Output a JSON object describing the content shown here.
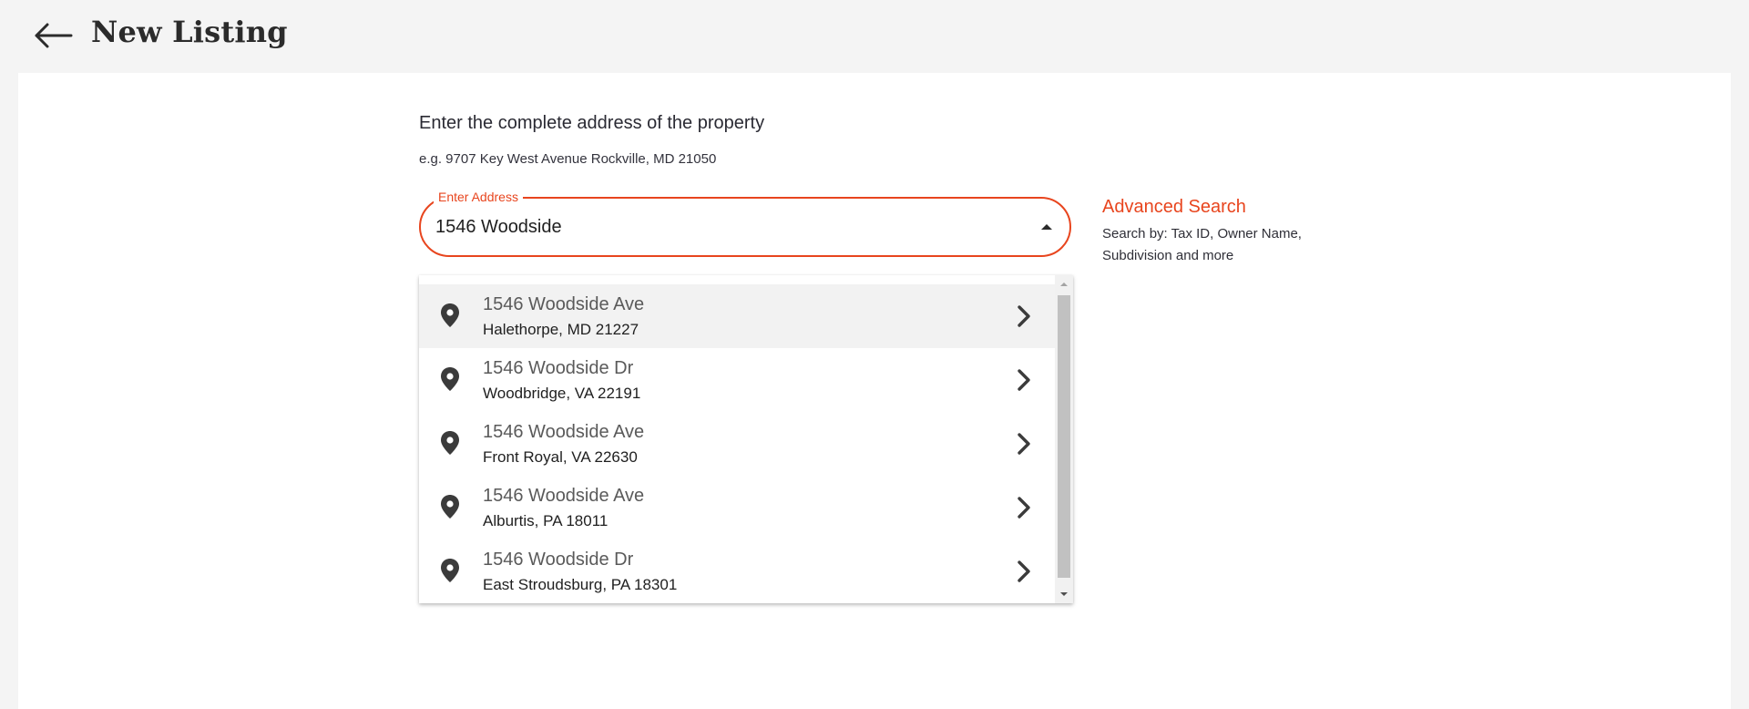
{
  "header": {
    "back_icon": "arrow-left-icon",
    "title": "New Listing"
  },
  "form": {
    "prompt": "Enter the complete address of the property",
    "example": "e.g. 9707 Key West Avenue Rockville, MD 21050",
    "address_label": "Enter Address",
    "address_value": "1546 Woodside",
    "caret_icon": "caret-up-icon"
  },
  "advanced": {
    "link": "Advanced Search",
    "description": "Search by: Tax ID, Owner Name, Subdivision and more"
  },
  "suggestions": [
    {
      "street": "1546 Woodside Ave",
      "locality": "Halethorpe, MD 21227",
      "active": true
    },
    {
      "street": "1546 Woodside Dr",
      "locality": "Woodbridge, VA 22191"
    },
    {
      "street": "1546 Woodside Ave",
      "locality": "Front Royal, VA 22630"
    },
    {
      "street": "1546 Woodside Ave",
      "locality": "Alburtis, PA 18011"
    },
    {
      "street": "1546 Woodside Dr",
      "locality": "East Stroudsburg, PA 18301"
    }
  ],
  "colors": {
    "accent": "#e8451e",
    "page_bg": "#f4f4f4",
    "card_bg": "#ffffff",
    "active_row": "#f2f2f2"
  },
  "icons": {
    "pin": "location-pin-icon",
    "chevron": "chevron-right-icon"
  }
}
